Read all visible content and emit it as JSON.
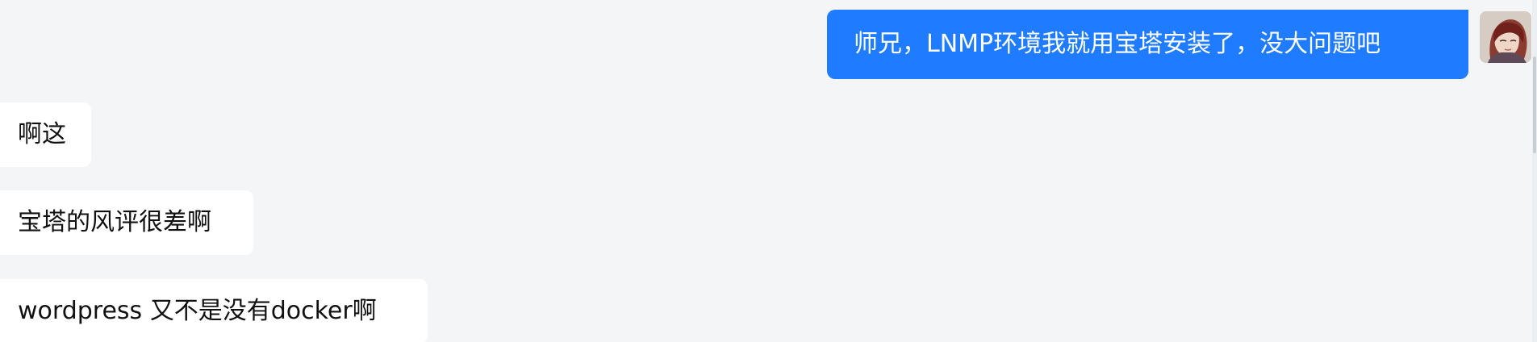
{
  "messages": {
    "outgoing": [
      {
        "text": "师兄，LNMP环境我就用宝塔安装了，没大问题吧"
      }
    ],
    "incoming": [
      {
        "text": "啊这"
      },
      {
        "text": "宝塔的风评很差啊"
      },
      {
        "text": "wordpress 又不是没有docker啊"
      }
    ]
  },
  "colors": {
    "background": "#f4f5f7",
    "outgoing_bubble": "#1f7bff",
    "incoming_bubble": "#ffffff"
  },
  "icons": {
    "avatar": "user-avatar"
  }
}
